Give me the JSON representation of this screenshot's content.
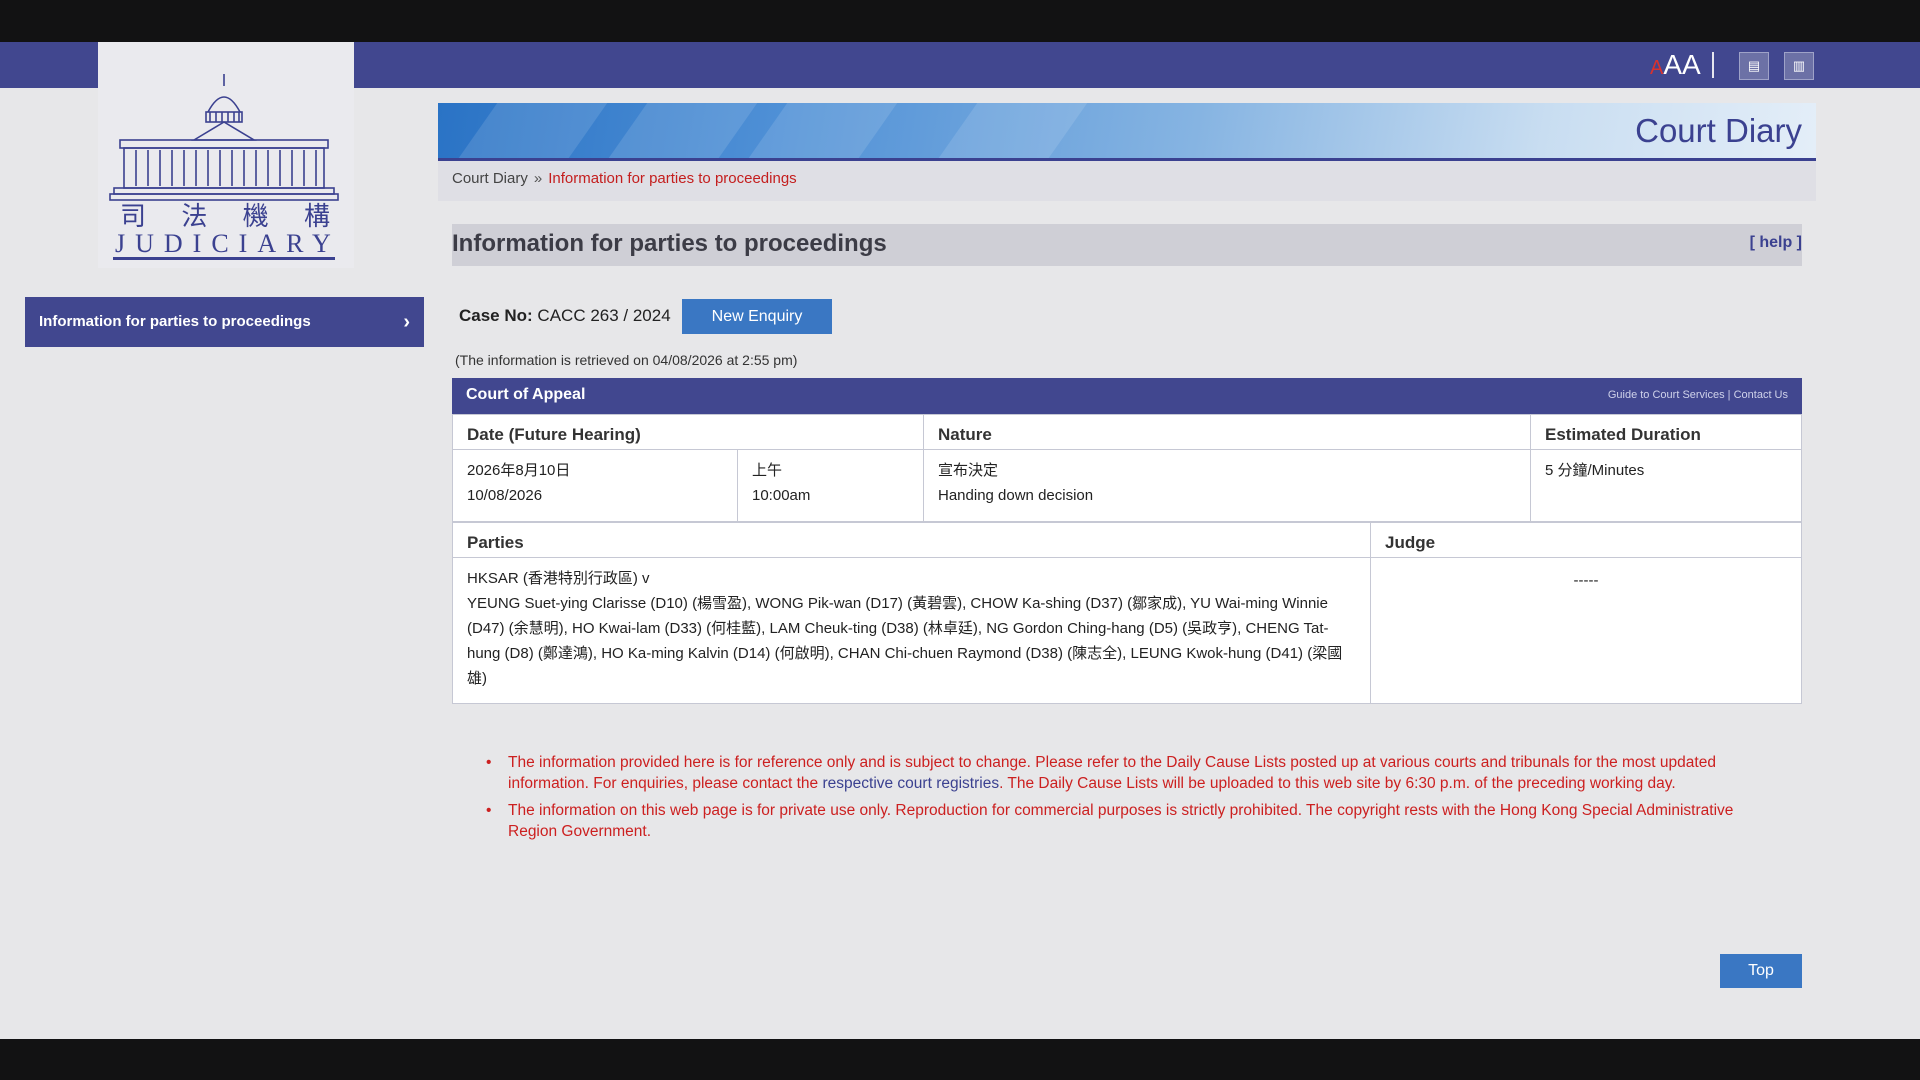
{
  "logo": {
    "chinese_chars": [
      "司",
      "法",
      "機",
      "構"
    ],
    "english": "JUDICIARY",
    "icon": "judiciary-building-icon"
  },
  "utility": {
    "font_size_label_small": "A",
    "font_size_label_large": "A",
    "icons": [
      "chinese-language-icon",
      "simplified-chinese-icon"
    ]
  },
  "sidebar": {
    "items": [
      {
        "label": "Information for parties to proceedings",
        "chevron": "›"
      }
    ]
  },
  "banner": {
    "title": "Court Diary"
  },
  "breadcrumb": {
    "root": "Court Diary",
    "separator": "»",
    "current": "Information for parties to proceedings"
  },
  "section": {
    "title": "Information for parties to proceedings",
    "help": "[ help ]"
  },
  "case": {
    "label": "Case No:",
    "number": "CACC 263 / 2024",
    "new_enquiry_label": "New Enquiry",
    "retrieved_text": "(The information is retrieved on 04/08/2026 at 2:55 pm)"
  },
  "court": {
    "name": "Court of Appeal",
    "links": "Guide to Court Services | Contact Us"
  },
  "hearing_table": {
    "headers": {
      "date": "Date (Future Hearing)",
      "nature": "Nature",
      "duration": "Estimated Duration"
    },
    "row": {
      "date_zh": "2026年8月10日",
      "date_en": "10/08/2026",
      "time_zh": "上午",
      "time_en": "10:00am",
      "nature_zh": "宣布決定",
      "nature_en": "Handing down decision",
      "duration": "5 分鐘/Minutes"
    }
  },
  "parties_table": {
    "headers": {
      "parties": "Parties",
      "judge": "Judge"
    },
    "parties_line1": "HKSAR (香港特別行政區) v",
    "parties_line2": "YEUNG Suet-ying Clarisse (D10) (楊雪盈), WONG Pik-wan (D17) (黃碧雲), CHOW Ka-shing (D37) (鄒家成), YU Wai-ming Winnie (D47) (余慧明), HO Kwai-lam (D33) (何桂藍), LAM Cheuk-ting (D38) (林卓廷), NG Gordon Ching-hang (D5) (吳政亨), CHENG Tat-hung (D8) (鄭達鴻), HO Ka-ming Kalvin (D14) (何啟明), CHAN Chi-chuen Raymond (D38) (陳志全), LEUNG Kwok-hung (D41) (梁國雄)",
    "judge": "-----"
  },
  "notes": [
    {
      "text_before": "The information provided here is for reference only and is subject to change. Please refer to the Daily Cause Lists posted up at various courts and tribunals for the most updated information. For enquiries, please contact the ",
      "link": "respective court registries",
      "text_after": ". The Daily Cause Lists will be uploaded to this web site by 6:30 p.m. of the preceding working day."
    },
    {
      "text_before": "The information on this web page is for private use only. Reproduction for commercial purposes is strictly prohibited. The copyright rests with the Hong Kong Special Administrative Region Government.",
      "link": "",
      "text_after": ""
    }
  ],
  "top_button": {
    "label": "Top"
  },
  "colors": {
    "brand_navy": "#41478f",
    "button_blue": "#3a77c3",
    "note_red": "#cc2020",
    "page_bg": "#e7e7e9"
  }
}
